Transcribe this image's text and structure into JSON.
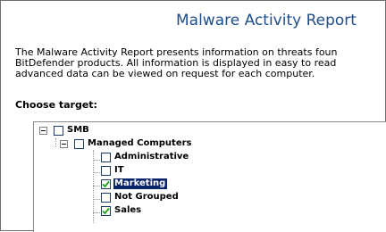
{
  "report": {
    "title": "Malware Activity Report",
    "description": [
      "The Malware Activity Report presents information on threats foun",
      "BitDefender products. All information is displayed in easy to read",
      "advanced data can be viewed on request for each computer."
    ],
    "choose_label": "Choose target:"
  },
  "tree": {
    "root": {
      "label": "SMB",
      "checked": false,
      "expanded": true
    },
    "group": {
      "label": "Managed Computers",
      "checked": false,
      "expanded": true
    },
    "items": [
      {
        "label": "Administrative",
        "checked": false,
        "selected": false
      },
      {
        "label": "IT",
        "checked": false,
        "selected": false
      },
      {
        "label": "Marketing",
        "checked": true,
        "selected": true
      },
      {
        "label": "Not Grouped",
        "checked": false,
        "selected": false
      },
      {
        "label": "Sales",
        "checked": true,
        "selected": false
      }
    ]
  },
  "colors": {
    "title": "#1f4e8c",
    "selection": "#0a246a",
    "check": "#1aa31a"
  }
}
